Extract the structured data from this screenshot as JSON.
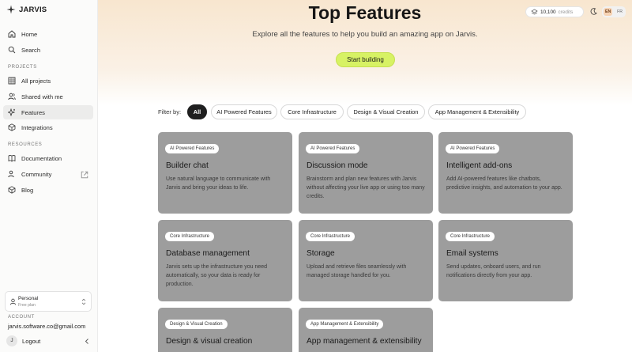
{
  "brand": {
    "name": "JARVIS"
  },
  "sidebar": {
    "nav": [
      {
        "label": "Home",
        "icon": "home-icon"
      },
      {
        "label": "Search",
        "icon": "search-icon"
      }
    ],
    "projects_label": "PROJECTS",
    "projects": [
      {
        "label": "All projects",
        "icon": "grid-icon"
      },
      {
        "label": "Shared with me",
        "icon": "users-icon"
      },
      {
        "label": "Features",
        "icon": "sparkle-icon",
        "active": true
      },
      {
        "label": "Integrations",
        "icon": "cube-icon"
      }
    ],
    "resources_label": "RESOURCES",
    "resources": [
      {
        "label": "Documentation",
        "icon": "book-icon"
      },
      {
        "label": "Community",
        "icon": "people-icon"
      },
      {
        "label": "Blog",
        "icon": "box-icon"
      }
    ],
    "workspace": {
      "name": "Personal",
      "plan": "Free plan"
    },
    "account_label": "ACCOUNT",
    "account_email": "jarvis.software.co@gmail.com",
    "avatar_initial": "J",
    "logout_label": "Logout"
  },
  "header": {
    "credits_value": "10,100",
    "credits_label": "credits",
    "lang_active": "EN",
    "lang_other": "FR"
  },
  "hero": {
    "title": "Top Features",
    "subtitle": "Explore all the features to help you build an amazing app on Jarvis.",
    "cta_label": "Start building"
  },
  "filters": {
    "label": "Filter by:",
    "chips": [
      "All",
      "AI Powered Features",
      "Core Infrastructure",
      "Design & Visual Creation",
      "App Management & Extensibility"
    ],
    "active_index": 0
  },
  "cards": [
    {
      "badge": "AI Powered Features",
      "title": "Builder chat",
      "desc": "Use natural language to communicate with Jarvis and bring your ideas to life."
    },
    {
      "badge": "AI Powered Features",
      "title": "Discussion mode",
      "desc": "Brainstorm and plan new features with Jarvis without affecting your live app or using too many credits."
    },
    {
      "badge": "AI Powered Features",
      "title": "Intelligent add-ons",
      "desc": "Add AI-powered features like chatbots, predictive insights, and automation to your app."
    },
    {
      "badge": "Core Infrastructure",
      "title": "Database management",
      "desc": "Jarvis sets up the infrastructure you need automatically, so your data is ready for production."
    },
    {
      "badge": "Core Infrastructure",
      "title": "Storage",
      "desc": "Upload and retrieve files seamlessly with managed storage handled for you."
    },
    {
      "badge": "Core Infrastructure",
      "title": "Email systems",
      "desc": "Send updates, onboard users, and run notifications directly from your app."
    },
    {
      "badge": "Design & Visual Creation",
      "title": "Design & visual creation",
      "desc": ""
    },
    {
      "badge": "App Management & Extensibility",
      "title": "App management & extensibility",
      "desc": ""
    }
  ],
  "colors": {
    "accent": "#d7f264",
    "card_bg": "#9d9d9d",
    "active_chip": "#1f1f1f"
  }
}
